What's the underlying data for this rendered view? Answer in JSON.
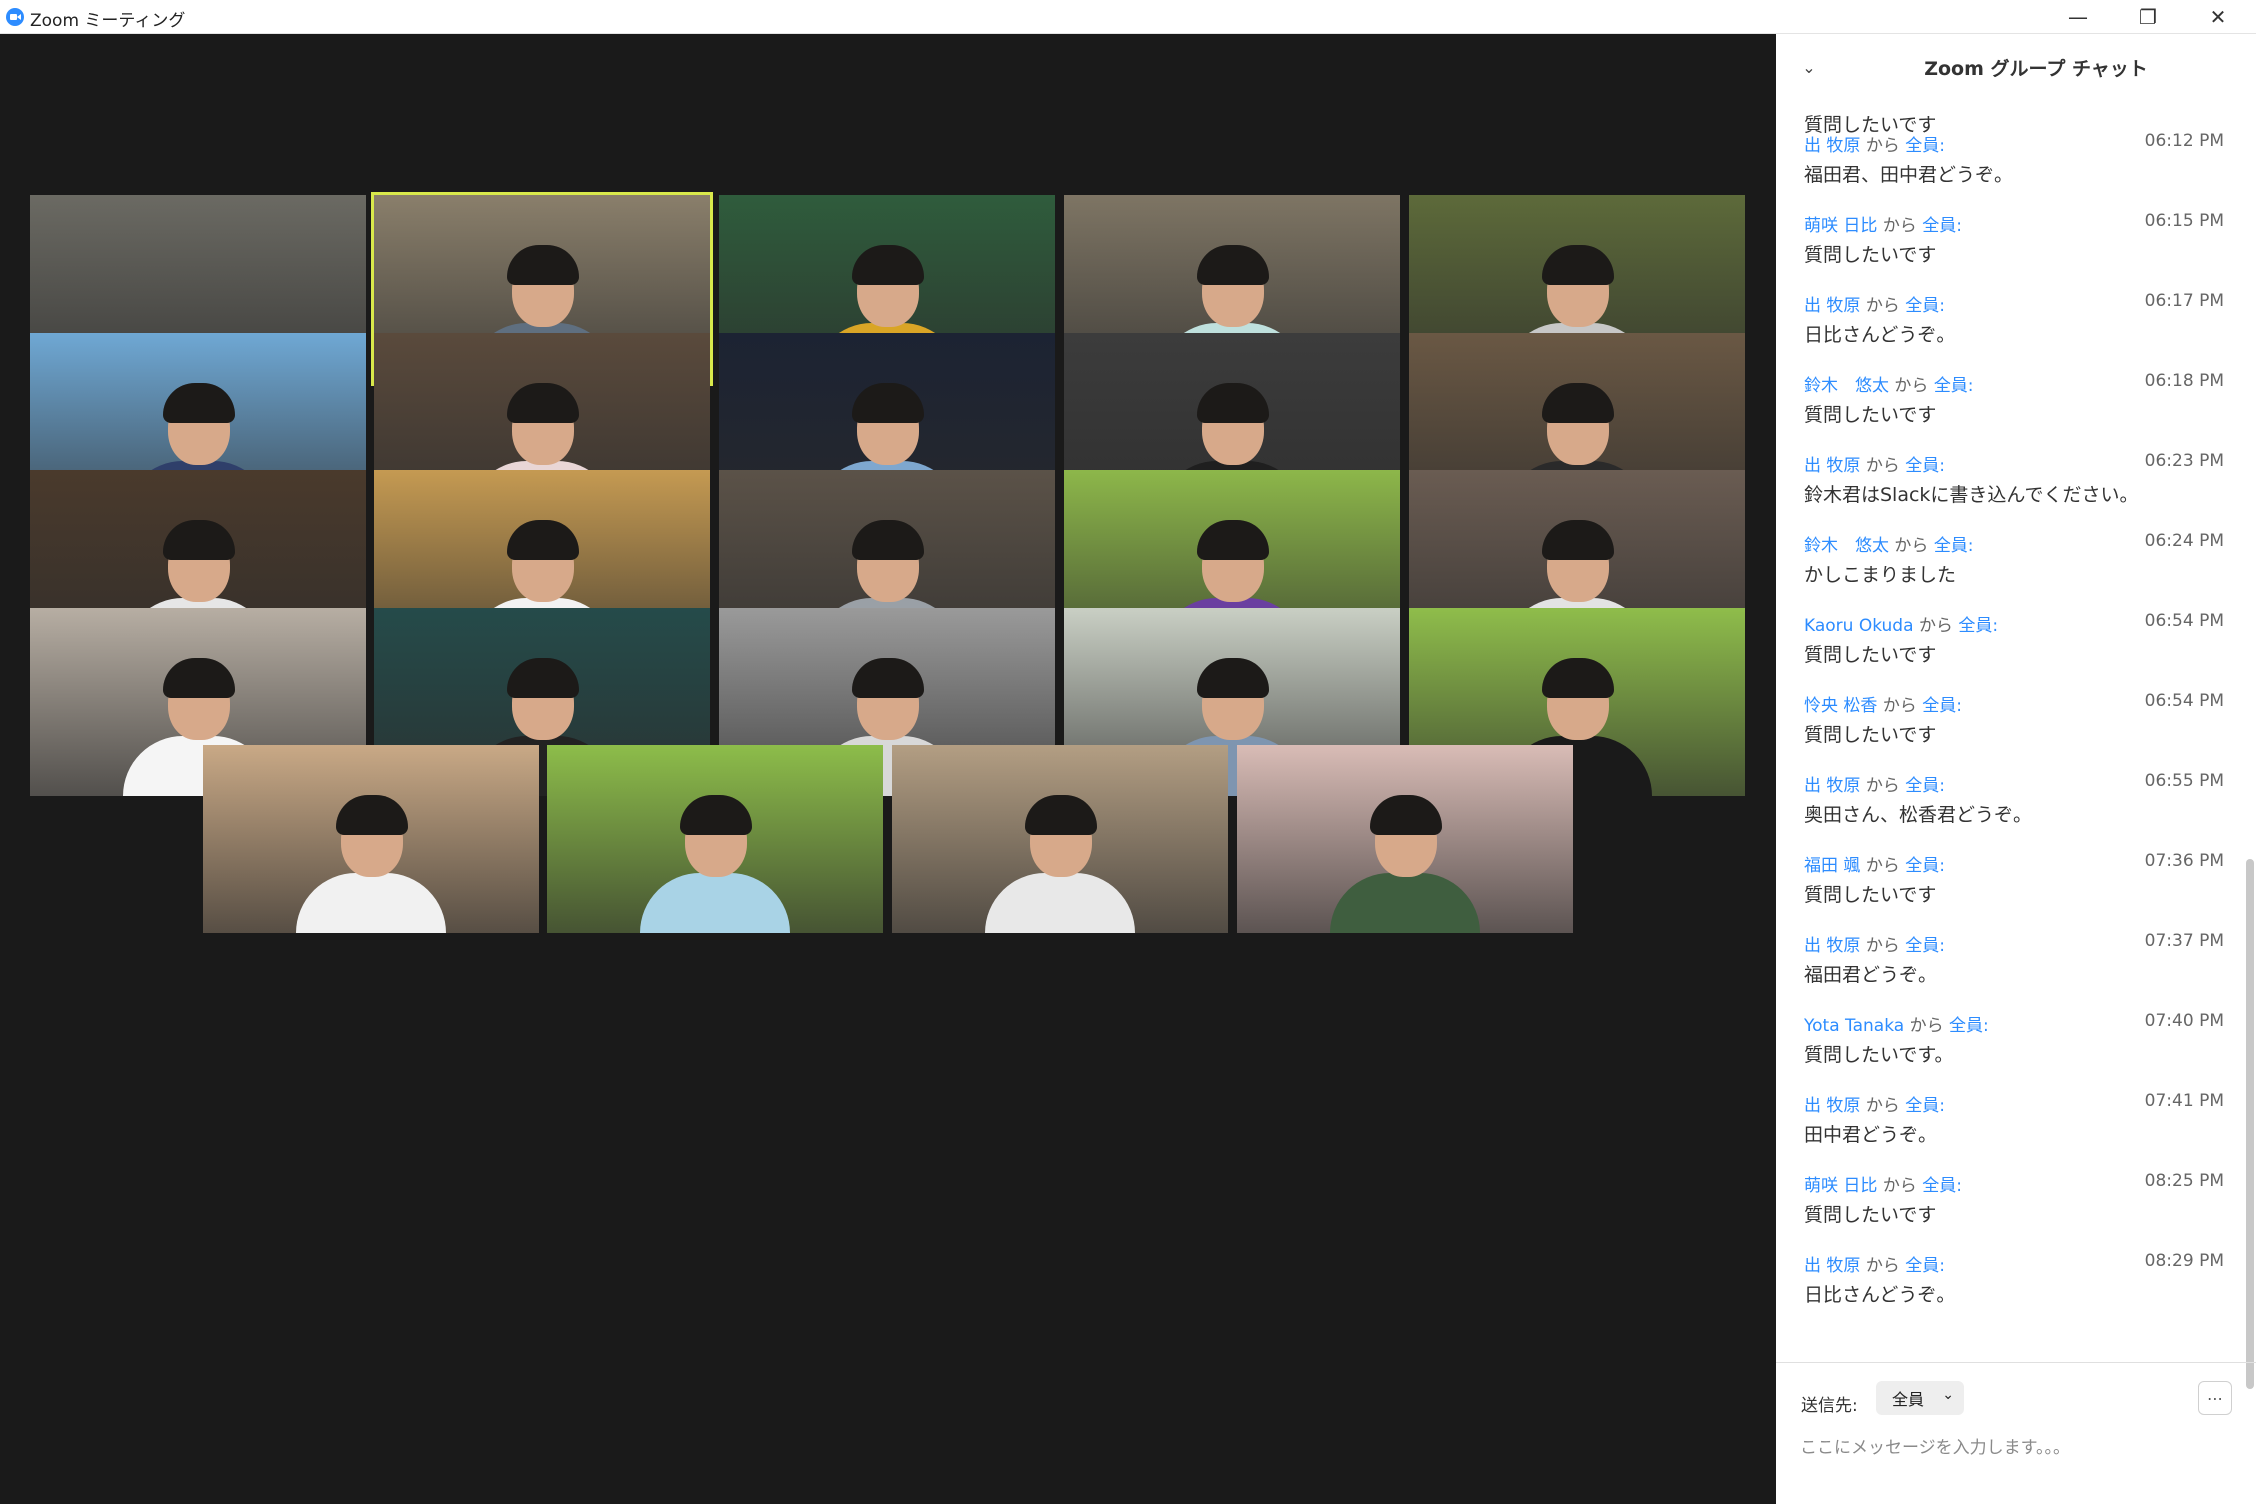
{
  "window": {
    "title": "Zoom ミーティング"
  },
  "chat": {
    "title": "Zoom グループ チャット",
    "first_text": "質問したいです",
    "kara": "から",
    "messages": [
      {
        "sender": "出 牧原",
        "to": "全員:",
        "time": "06:12 PM",
        "text": "福田君、田中君どうぞ。"
      },
      {
        "sender": "萌咲 日比",
        "to": "全員:",
        "time": "06:15 PM",
        "text": "質問したいです"
      },
      {
        "sender": "出 牧原",
        "to": "全員:",
        "time": "06:17 PM",
        "text": "日比さんどうぞ。"
      },
      {
        "sender": "鈴木　悠太",
        "to": "全員:",
        "time": "06:18 PM",
        "text": "質問したいです"
      },
      {
        "sender": "出 牧原",
        "to": "全員:",
        "time": "06:23 PM",
        "text": "鈴木君はSlackに書き込んでください。"
      },
      {
        "sender": "鈴木　悠太",
        "to": "全員:",
        "time": "06:24 PM",
        "text": "かしこまりました"
      },
      {
        "sender": "Kaoru Okuda",
        "to": "全員:",
        "time": "06:54 PM",
        "text": "質問したいです"
      },
      {
        "sender": "怜央 松香",
        "to": "全員:",
        "time": "06:54 PM",
        "text": "質問したいです"
      },
      {
        "sender": "出 牧原",
        "to": "全員:",
        "time": "06:55 PM",
        "text": "奥田さん、松香君どうぞ。"
      },
      {
        "sender": "福田 颯",
        "to": "全員:",
        "time": "07:36 PM",
        "text": "質問したいです"
      },
      {
        "sender": "出 牧原",
        "to": "全員:",
        "time": "07:37 PM",
        "text": "福田君どうぞ。"
      },
      {
        "sender": "Yota Tanaka",
        "to": "全員:",
        "time": "07:40 PM",
        "text": "質問したいです。"
      },
      {
        "sender": "出 牧原",
        "to": "全員:",
        "time": "07:41 PM",
        "text": "田中君どうぞ。"
      },
      {
        "sender": "萌咲 日比",
        "to": "全員:",
        "time": "08:25 PM",
        "text": "質問したいです"
      },
      {
        "sender": "出 牧原",
        "to": "全員:",
        "time": "08:29 PM",
        "text": "日比さんどうぞ。"
      }
    ],
    "footer": {
      "to_label": "送信先:",
      "to_value": "全員",
      "input_placeholder": "ここにメッセージを入力します。。。"
    }
  },
  "colors": {
    "accent": "#2d8cff",
    "active_speaker": "#d9e94b"
  },
  "tiles": [
    {
      "bg": "#6b6a63",
      "shirt": "#7f7f7f",
      "person": false
    },
    {
      "bg": "#8a7f6b",
      "shirt": "#5f6f80",
      "person": true,
      "active": true
    },
    {
      "bg": "#2f5c3c",
      "shirt": "#d9a526",
      "person": true
    },
    {
      "bg": "#7e7564",
      "shirt": "#bfe0dd",
      "person": true
    },
    {
      "bg": "#5d6a3a",
      "shirt": "#c7c7c7",
      "person": true
    },
    {
      "bg": "#6fa8d4",
      "shirt": "#2f3f6a",
      "person": true
    },
    {
      "bg": "#5a4a3c",
      "shirt": "#e9d6d6",
      "person": true
    },
    {
      "bg": "#1c2333",
      "shirt": "#7ea7cf",
      "person": true
    },
    {
      "bg": "#3c3c3c",
      "shirt": "#1f1f1f",
      "person": true
    },
    {
      "bg": "#6a5844",
      "shirt": "#2a2a2a",
      "person": true
    },
    {
      "bg": "#4a3a2c",
      "shirt": "#e6e6e6",
      "person": true
    },
    {
      "bg": "#c59a52",
      "shirt": "#f2f2f2",
      "person": true
    },
    {
      "bg": "#5b5248",
      "shirt": "#9aa0a6",
      "person": true
    },
    {
      "bg": "#8db74a",
      "shirt": "#6a3fa0",
      "person": true
    },
    {
      "bg": "#6a5c52",
      "shirt": "#e3e3e3",
      "person": true
    },
    {
      "bg": "#b7aea3",
      "shirt": "#f5f5f5",
      "person": true
    },
    {
      "bg": "#254b4a",
      "shirt": "#222222",
      "person": true
    },
    {
      "bg": "#9a9a9a",
      "shirt": "#d8d8d8",
      "person": true
    },
    {
      "bg": "#c9cfc4",
      "shirt": "#7e95b0",
      "person": true
    },
    {
      "bg": "#8fbd4b",
      "shirt": "#1a1a1a",
      "person": true
    },
    {
      "bg": "#c9a986",
      "shirt": "#f1f1f1",
      "person": true
    },
    {
      "bg": "#8dbd4a",
      "shirt": "#a9d3e6",
      "person": true
    },
    {
      "bg": "#b39e83",
      "shirt": "#e8e8e8",
      "person": true
    },
    {
      "bg": "#d9bcb6",
      "shirt": "#3f5e3f",
      "person": true
    }
  ]
}
